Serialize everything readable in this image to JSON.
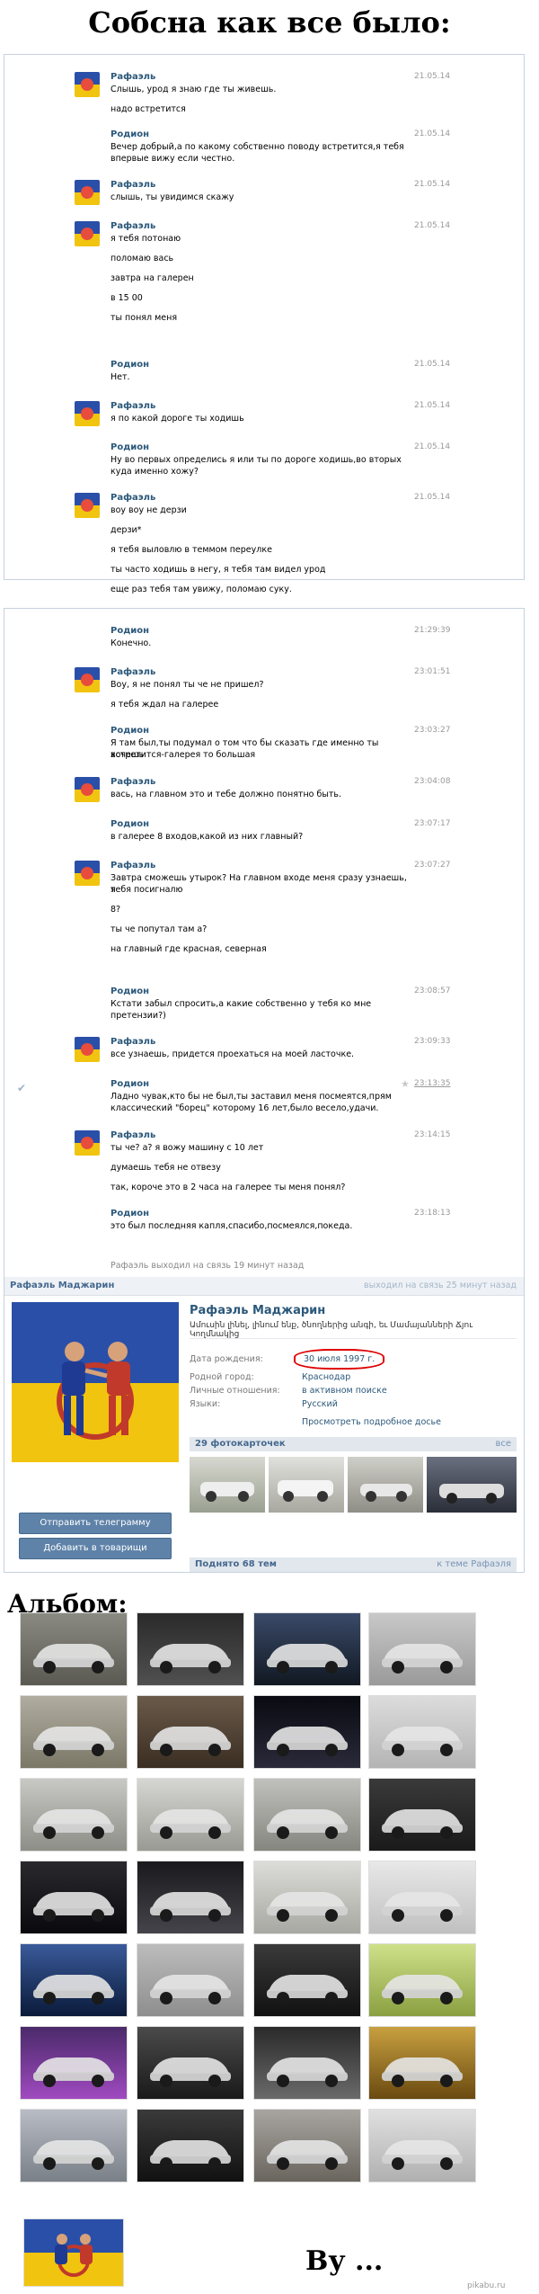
{
  "header": {
    "title": "Собсна как все было:"
  },
  "chat": {
    "status_offline": "Рафаэль выходил на связь 19 минут назад",
    "messages": [
      {
        "sender": "Рафаэль",
        "time": "21.05.14",
        "lines": [
          "Слышь, урод я знаю где ты живешь.",
          "надо встретится"
        ]
      },
      {
        "sender": "Родион",
        "time": "21.05.14",
        "lines": [
          "Вечер добрый,а по какому собственно поводу встретится,я тебя",
          "впервые вижу если честно."
        ]
      },
      {
        "sender": "Рафаэль",
        "time": "21.05.14",
        "lines": [
          "слышь, ты увидимся скажу"
        ]
      },
      {
        "sender": "Рафаэль",
        "time": "21.05.14",
        "lines": [
          "я тебя потонаю",
          "поломаю вась",
          "завтра на галерен",
          "в 15 00",
          "ты понял меня"
        ]
      },
      {
        "sender": "Родион",
        "time": "21.05.14",
        "lines": [
          "Нет."
        ]
      },
      {
        "sender": "Рафаэль",
        "time": "21.05.14",
        "lines": [
          "я по какой дороге ты ходишь"
        ]
      },
      {
        "sender": "Родион",
        "time": "21.05.14",
        "lines": [
          "Ну во первых определись я или ты по дороге ходишь,во вторых",
          "куда именно хожу?"
        ]
      },
      {
        "sender": "Рафаэль",
        "time": "21.05.14",
        "lines": [
          "воу воу не дерзи",
          "дерзи*",
          "я тебя выловлю в теммом переулке",
          "ты часто ходишь в негу, я тебя там видел урод",
          "еще раз тебя там увижу, поломаю суку."
        ]
      },
      {
        "sender": "Родион",
        "time": "21:29:39",
        "lines": [
          "Конечно."
        ]
      },
      {
        "sender": "Рафаэль",
        "time": "23:01:51",
        "lines": [
          "Воу, я не понял ты че не пришел?",
          "я тебя ждал на галерее"
        ]
      },
      {
        "sender": "Родион",
        "time": "23:03:27",
        "lines": [
          "Я там был,ты подумал о том что бы сказать где именно ты хочешь",
          "встретится-галерея то большая"
        ]
      },
      {
        "sender": "Рафаэль",
        "time": "23:04:08",
        "lines": [
          "вась, на главном это и тебе должно понятно быть."
        ]
      },
      {
        "sender": "Родион",
        "time": "23:07:17",
        "lines": [
          "в галерее 8 входов,какой из них главный?"
        ]
      },
      {
        "sender": "Рафаэль",
        "time": "23:07:27",
        "lines": [
          "Завтра сможешь утырок? На главном входе меня сразу узнаешь, я",
          "тебя посигналю",
          "8?",
          "ты че попутал там а?",
          "на главный где красная, северная"
        ]
      },
      {
        "sender": "Родион",
        "time": "23:08:57",
        "lines": [
          "Кстати забыл спросить,а какие собственно у тебя ко мне",
          "претензии?)"
        ]
      },
      {
        "sender": "Рафаэль",
        "time": "23:09:33",
        "lines": [
          "все узнаешь, придется проехаться на моей ласточке."
        ]
      },
      {
        "sender": "Родион",
        "time": "23:13:35",
        "lines": [
          "Ладно чувак,кто бы не был,ты заставил меня посмеятся,прям",
          "классический \"борец\" которому 16 лет,было весело,удачи."
        ]
      },
      {
        "sender": "Рафаэль",
        "time": "23:14:15",
        "lines": [
          "ты че? а? я вожу машину с 10 лет",
          "думаешь тебя не отвезу",
          "так, короче это в 2 часа на галерее ты меня понял?"
        ]
      },
      {
        "sender": "Родион",
        "time": "23:18:13",
        "lines": [
          "это был последняя капля,спасибо,посмеялся,покеда."
        ]
      }
    ]
  },
  "profile": {
    "header_name": "Рафаэль Маджарин",
    "header_online": "выходил на связь 25 минут назад",
    "name": "Рафаэль Маджарин",
    "status": "Ամուսին լինել, լինում ենք, ծնողներից անգի, եւ Մամայանների Ճյու Կողմնակից",
    "labels": [
      "Дата рождения:",
      "Родной город:",
      "Личные отношения:",
      "Языки:"
    ],
    "values": [
      "30 июля 1997 г.",
      "Краснодар",
      "в активном поиске",
      "Русский"
    ],
    "more_link": "Просмотреть подробное досье",
    "btn_send": "Отправить телеграмму",
    "btn_add": "Добавить в товарищи",
    "photos_label": "29 фотокарточек",
    "photos_all": "все",
    "wall_label": "Поднято 68 тем",
    "wall_right": "к теме Рафаэля"
  },
  "album": {
    "title": "Альбом:"
  },
  "footer": {
    "text": "Ву ...",
    "watermark": "pikabu.ru"
  },
  "colors": {
    "link": "#2b587a",
    "button": "#5e82a8",
    "border": "#c5d2e1",
    "highlight": "#e00000"
  },
  "icons": {
    "read_check": "check-icon",
    "favorite": "star-icon"
  }
}
